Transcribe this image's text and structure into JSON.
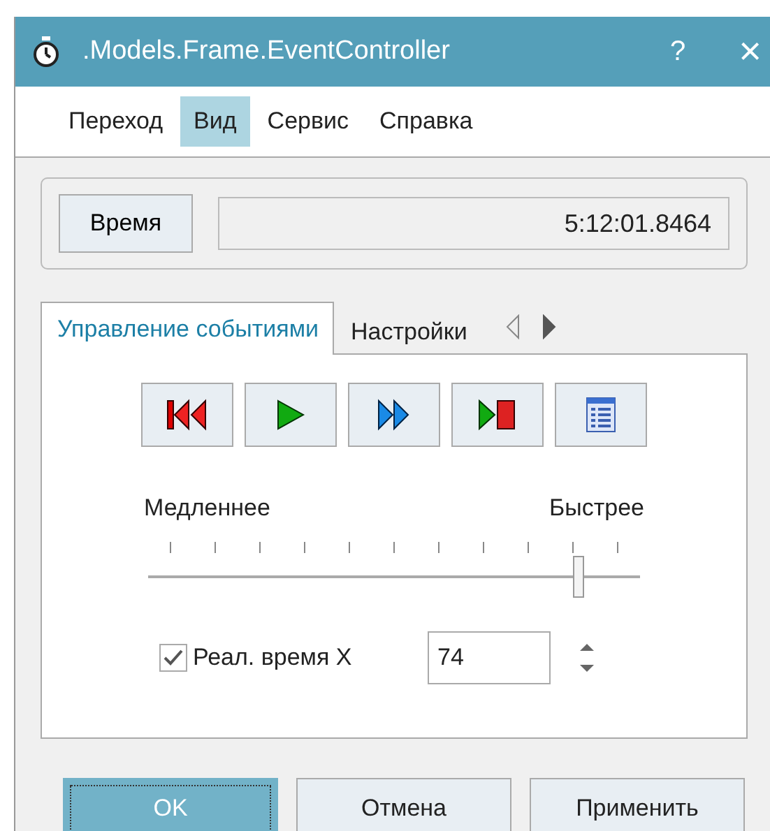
{
  "window": {
    "title": ".Models.Frame.EventController",
    "help": "?",
    "close": "×"
  },
  "menu": [
    {
      "label": "Переход",
      "selected": false
    },
    {
      "label": "Вид",
      "selected": true
    },
    {
      "label": "Сервис",
      "selected": false
    },
    {
      "label": "Справка",
      "selected": false
    }
  ],
  "time": {
    "button": "Время",
    "value": "5:12:01.8464"
  },
  "tabs": [
    {
      "label": "Управление событиями",
      "selected": true
    },
    {
      "label": "Настройки",
      "selected": false
    }
  ],
  "tab_scroll": {
    "left_disabled": true,
    "right_disabled": false
  },
  "media_buttons": [
    {
      "kind": "rewind"
    },
    {
      "kind": "play"
    },
    {
      "kind": "forward"
    },
    {
      "kind": "stop"
    },
    {
      "kind": "list"
    }
  ],
  "speed": {
    "min_label": "Медленнее",
    "max_label": "Быстрее",
    "level": 0.875
  },
  "realtime": {
    "checked": true,
    "label": "Реал. время X",
    "value": "74"
  },
  "buttons": [
    {
      "label": "OK",
      "default": true
    },
    {
      "label": "Отмена",
      "default": false
    },
    {
      "label": "Применить",
      "default": false
    }
  ]
}
